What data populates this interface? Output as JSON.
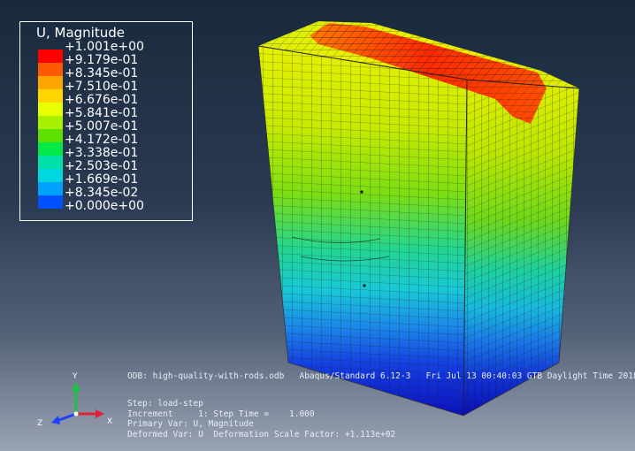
{
  "legend": {
    "title": "U, Magnitude",
    "values": [
      "+1.001e+00",
      "+9.179e-01",
      "+8.345e-01",
      "+7.510e-01",
      "+6.676e-01",
      "+5.841e-01",
      "+5.007e-01",
      "+4.172e-01",
      "+3.338e-01",
      "+2.503e-01",
      "+1.669e-01",
      "+8.345e-02",
      "+0.000e+00"
    ],
    "colors": [
      "#ff0000",
      "#ff5a00",
      "#ffa500",
      "#ffd400",
      "#e8ff00",
      "#a6f000",
      "#5ee000",
      "#00e84a",
      "#00e0a8",
      "#00d8e0",
      "#00a0ff",
      "#0050ff",
      "#0000e0"
    ]
  },
  "info": {
    "odb": "ODB: high-quality-with-rods.odb",
    "solver": "Abaqus/Standard 6.12-3",
    "timestamp": "Fri Jul 13 00:40:03 GTB Daylight Time 2018",
    "step": "Step: load-step",
    "increment": "Increment     1: Step Time =    1.000",
    "primary_var": "Primary Var: U, Magnitude",
    "deformed_var": "Deformed Var: U  Deformation Scale Factor: +1.113e+02"
  },
  "triad": {
    "x_label": "X",
    "y_label": "Y",
    "z_label": "Z",
    "x_color": "#e0203a",
    "y_color": "#20c040",
    "z_color": "#2040ff"
  }
}
